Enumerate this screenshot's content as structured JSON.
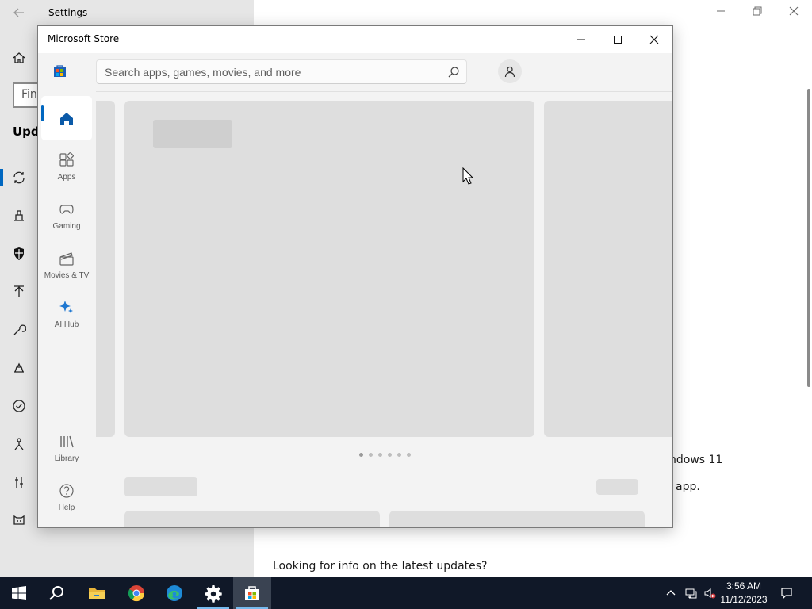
{
  "settings_window": {
    "title": "Settings",
    "search_placeholder": "Fin",
    "section_title": "Upda",
    "right_text_1": "ndows 11",
    "right_text_2": "app.",
    "right_text_3": "Looking for info on the latest updates?"
  },
  "store_window": {
    "title": "Microsoft Store",
    "search_placeholder": "Search apps, games, movies, and more",
    "rail": [
      {
        "label": ""
      },
      {
        "label": "Apps"
      },
      {
        "label": "Gaming"
      },
      {
        "label": "Movies & TV"
      },
      {
        "label": "AI Hub"
      },
      {
        "label": "Library"
      },
      {
        "label": "Help"
      }
    ],
    "carousel_dots": 6,
    "accent_color": "#0067c0"
  },
  "taskbar": {
    "time": "3:56 AM",
    "date": "11/12/2023",
    "apps": [
      "start-icon",
      "search-icon",
      "file-explorer-icon",
      "chrome-icon",
      "edge-icon",
      "settings-icon",
      "microsoft-store-icon"
    ]
  }
}
